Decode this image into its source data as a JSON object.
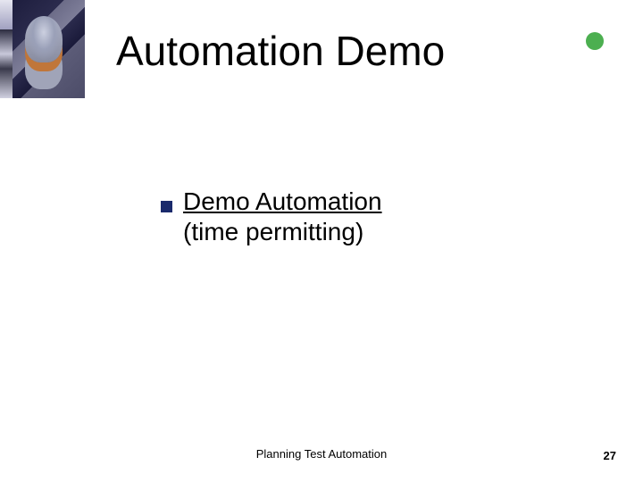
{
  "title": "Automation Demo",
  "bullets": [
    {
      "link_text": "Demo Automation",
      "sub_text": "(time permitting)"
    }
  ],
  "footer": {
    "center": "Planning Test Automation",
    "page": "27"
  },
  "accent": {
    "bullet_color": "#1a2a6c",
    "dot_color": "#4CAF50"
  }
}
